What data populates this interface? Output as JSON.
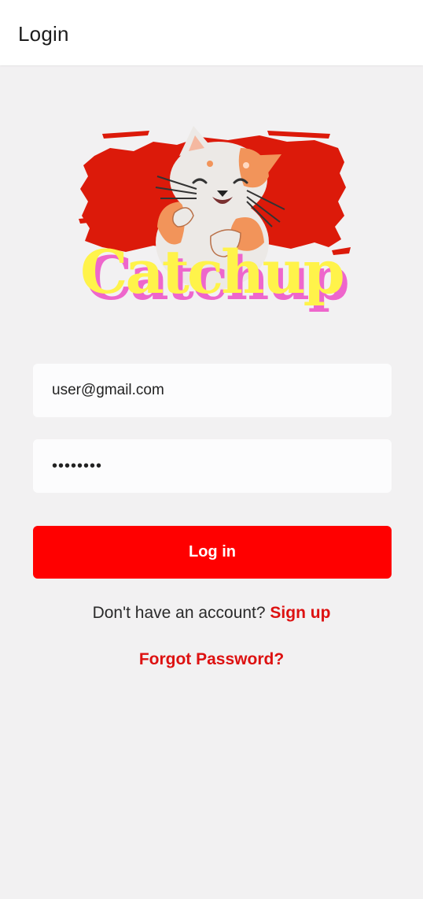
{
  "app_bar": {
    "title": "Login"
  },
  "logo": {
    "wordmark": "Catchup",
    "icon": "cat-logo-icon"
  },
  "form": {
    "email_value": "user@gmail.com",
    "password_value": "••••••••",
    "login_label": "Log in"
  },
  "signup": {
    "prompt": "Don't have an account?",
    "link": "Sign up"
  },
  "forgot_label": "Forgot Password?",
  "colors": {
    "primary": "#ff0000",
    "link": "#dd1111",
    "background": "#f2f1f2",
    "logo_brush": "#dc1a0a",
    "logo_text": "#fff34a",
    "logo_shadow": "#ee66cc",
    "cat_orange": "#f2945a"
  }
}
